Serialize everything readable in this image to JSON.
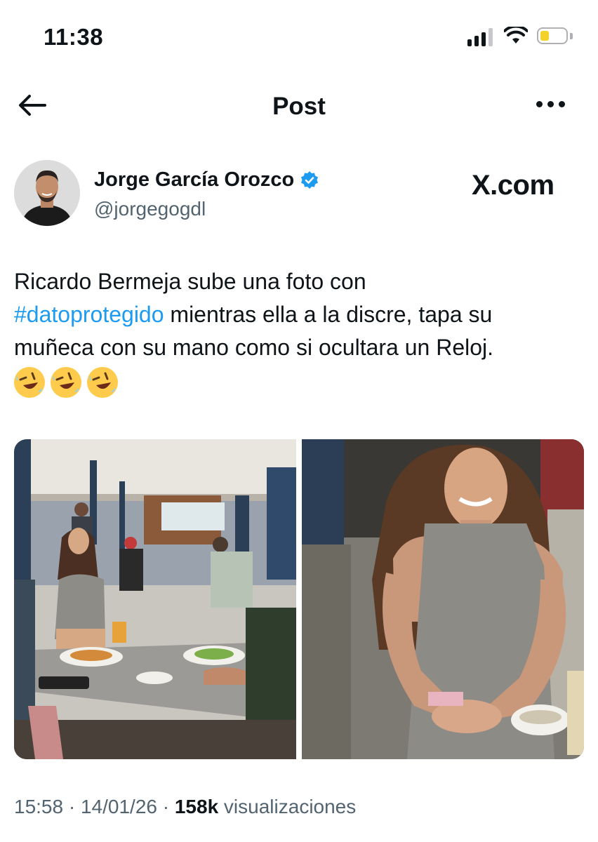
{
  "status_bar": {
    "time": "11:38"
  },
  "nav": {
    "title": "Post"
  },
  "author": {
    "name": "Jorge García Orozco",
    "handle": "@jorgegogdl",
    "verified": true
  },
  "source_watermark": "X.com",
  "post": {
    "line1": "Ricardo Bermeja sube una foto con",
    "hashtag": "#datoprotegido",
    "line2_rest": " mientras ella a la discre, tapa su",
    "line3": "muñeca con su mano como si ocultara un Reloj.",
    "emoji": [
      "rolling-on-floor-laughing",
      "rolling-on-floor-laughing",
      "rolling-on-floor-laughing"
    ]
  },
  "meta": {
    "time": "15:58",
    "sep1": " · ",
    "date": "14/01/26",
    "sep2": " · ",
    "views": "158k",
    "views_label": " visualizaciones"
  },
  "colors": {
    "accent": "#1d9bf0",
    "text": "#0f1419",
    "secondary": "#536471"
  }
}
